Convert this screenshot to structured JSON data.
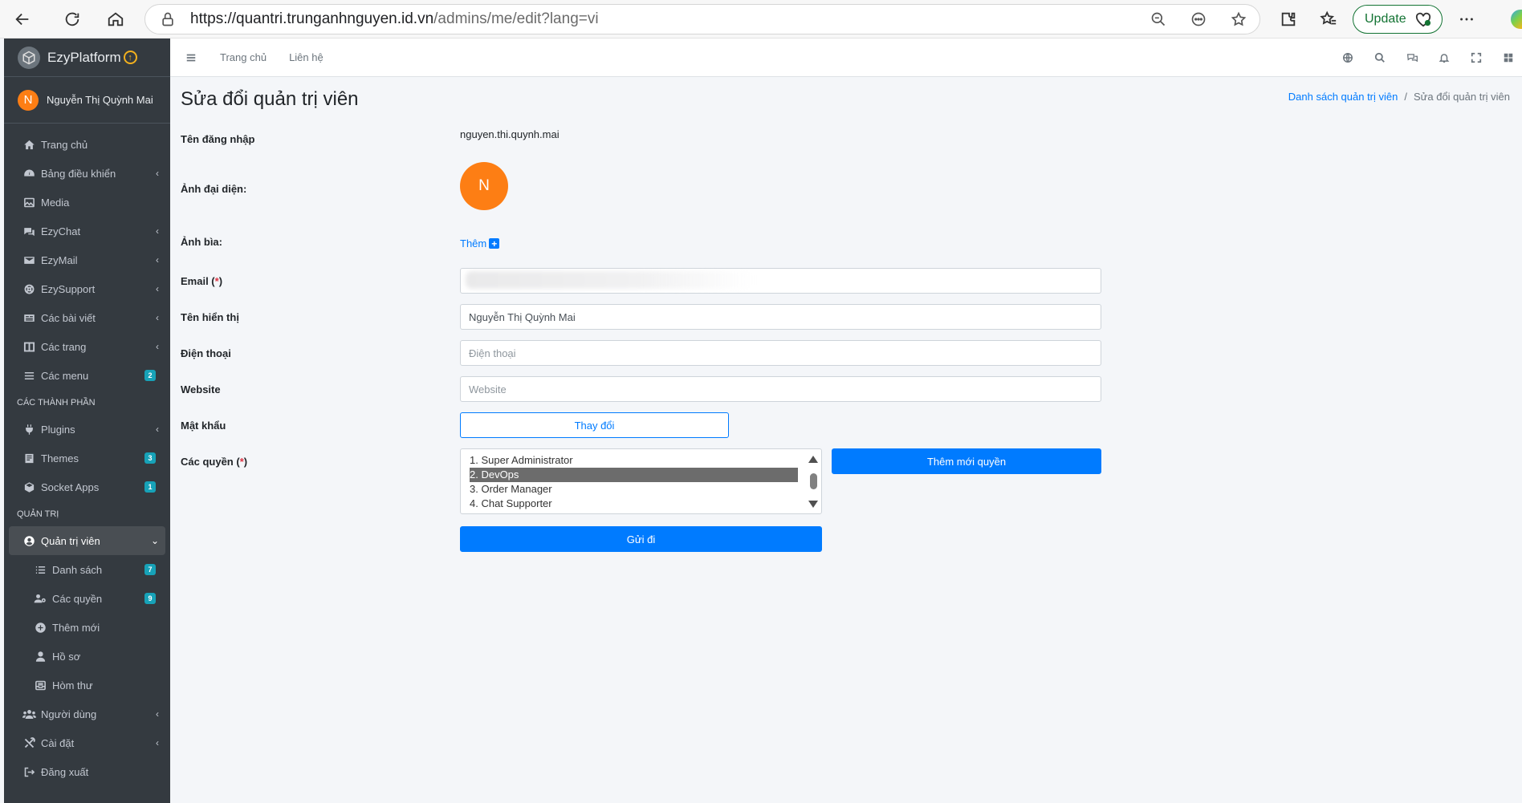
{
  "browser": {
    "url_host": "https://quantri.trunganhnguyen.id.vn",
    "url_path": "/admins/me/edit?lang=vi",
    "update_label": "Update"
  },
  "sidebar": {
    "brand": "EzyPlatform",
    "user_initial": "N",
    "user_name": "Nguyễn Thị Quỳnh Mai",
    "items": [
      {
        "label": "Trang chủ",
        "icon": "home-icon"
      },
      {
        "label": "Bảng điều khiển",
        "icon": "dashboard-icon"
      },
      {
        "label": "Media",
        "icon": "image-icon"
      },
      {
        "label": "EzyChat",
        "icon": "chat-icon"
      },
      {
        "label": "EzyMail",
        "icon": "mail-icon"
      },
      {
        "label": "EzySupport",
        "icon": "lifebuoy-icon"
      },
      {
        "label": "Các bài viết",
        "icon": "newspaper-icon"
      },
      {
        "label": "Các trang",
        "icon": "columns-icon"
      },
      {
        "label": "Các menu",
        "icon": "menu-icon",
        "badge": "2"
      }
    ],
    "header_components": "CÁC THÀNH PHẦN",
    "components": [
      {
        "label": "Plugins",
        "icon": "plug-icon"
      },
      {
        "label": "Themes",
        "icon": "themes-icon",
        "badge": "3"
      },
      {
        "label": "Socket Apps",
        "icon": "cube-icon",
        "badge": "1"
      }
    ],
    "header_admin": "QUẢN TRỊ",
    "admin_active": "Quản trị viên",
    "admin_sub": [
      {
        "label": "Danh sách",
        "icon": "list-icon",
        "badge": "7"
      },
      {
        "label": "Các quyền",
        "icon": "users-cog-icon",
        "badge": "9"
      },
      {
        "label": "Thêm mới",
        "icon": "plus-circle-icon"
      },
      {
        "label": "Hồ sơ",
        "icon": "user-icon"
      },
      {
        "label": "Hòm thư",
        "icon": "inbox-icon"
      }
    ],
    "bottom": [
      {
        "label": "Người dùng",
        "icon": "users-icon"
      },
      {
        "label": "Cài đặt",
        "icon": "tools-icon"
      },
      {
        "label": "Đăng xuất",
        "icon": "logout-icon"
      }
    ]
  },
  "header": {
    "home_link": "Trang chủ",
    "contact_link": "Liên hệ"
  },
  "page": {
    "title": "Sửa đổi quản trị viên",
    "breadcrumb_link": "Danh sách quản trị viên",
    "breadcrumb_sep": "/",
    "breadcrumb_current": "Sửa đổi quản trị viên"
  },
  "form": {
    "username_label": "Tên đăng nhập",
    "username_value": "nguyen.thi.quynh.mai",
    "avatar_label": "Ảnh đại diện:",
    "avatar_initial": "N",
    "cover_label": "Ảnh bìa:",
    "cover_add": "Thêm",
    "email_label": "Email (",
    "email_req": "*",
    "email_close": ")",
    "display_label": "Tên hiển thị",
    "display_value": "Nguyễn Thị Quỳnh Mai",
    "phone_label": "Điện thoại",
    "phone_placeholder": "Điện thoại",
    "website_label": "Website",
    "website_placeholder": "Website",
    "password_label": "Mật khẩu",
    "password_button": "Thay đổi",
    "roles_label": "Các quyền (",
    "roles_req": "*",
    "roles_close": ")",
    "roles_options": [
      "1. Super Administrator",
      "2. DevOps",
      "3. Order Manager",
      "4. Chat Supporter"
    ],
    "roles_selected_index": 1,
    "add_role_button": "Thêm mới quyền",
    "submit_button": "Gửi đi"
  }
}
